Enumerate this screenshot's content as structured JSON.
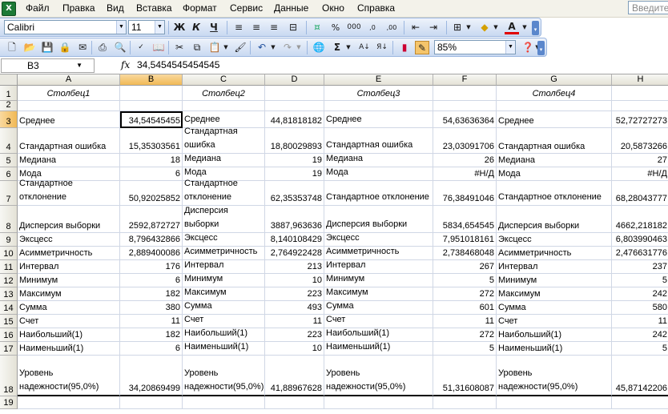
{
  "menu": {
    "items": [
      "Файл",
      "Правка",
      "Вид",
      "Вставка",
      "Формат",
      "Сервис",
      "Данные",
      "Окно",
      "Справка"
    ],
    "help_placeholder": "Введите"
  },
  "toolbar1": {
    "font_name": "Calibri",
    "font_size": "11"
  },
  "toolbar2": {
    "zoom": "85%"
  },
  "formula": {
    "cell_ref": "B3",
    "fx_label": "fx",
    "value": "34,5454545454545"
  },
  "columns": [
    "A",
    "B",
    "C",
    "D",
    "E",
    "F",
    "G",
    "H"
  ],
  "rows": {
    "r1": [
      "Столбец1",
      "",
      "Столбец2",
      "",
      "Столбец3",
      "",
      "Столбец4",
      ""
    ],
    "r2": [
      "",
      "",
      "",
      "",
      "",
      "",
      "",
      ""
    ],
    "r3": [
      "Среднее",
      "34,54545455",
      "Среднее",
      "44,81818182",
      "Среднее",
      "54,63636364",
      "Среднее",
      "52,72727273"
    ],
    "r4": [
      "Стандартная ошибка",
      "15,35303561",
      "Стандартная ошибка",
      "18,80029893",
      "Стандартная ошибка",
      "23,03091706",
      "Стандартная ошибка",
      "20,5873266"
    ],
    "r5": [
      "Медиана",
      "18",
      "Медиана",
      "19",
      "Медиана",
      "26",
      "Медиана",
      "27"
    ],
    "r6": [
      "Мода",
      "6",
      "Мода",
      "19",
      "Мода",
      "#Н/Д",
      "Мода",
      "#Н/Д"
    ],
    "r7": [
      "Стандартное отклонение",
      "50,92025852",
      "Стандартное отклонение",
      "62,35353748",
      "Стандартное отклонение",
      "76,38491046",
      "Стандартное отклонение",
      "68,28043777"
    ],
    "r8": [
      "Дисперсия выборки",
      "2592,872727",
      "Дисперсия выборки",
      "3887,963636",
      "Дисперсия выборки",
      "5834,654545",
      "Дисперсия выборки",
      "4662,218182"
    ],
    "r9": [
      "Эксцесс",
      "8,796432866",
      "Эксцесс",
      "8,140108429",
      "Эксцесс",
      "7,951018161",
      "Эксцесс",
      "6,803990463"
    ],
    "r10": [
      "Асимметричность",
      "2,889400086",
      "Асимметричность",
      "2,764922428",
      "Асимметричность",
      "2,738468048",
      "Асимметричность",
      "2,476631776"
    ],
    "r11": [
      "Интервал",
      "176",
      "Интервал",
      "213",
      "Интервал",
      "267",
      "Интервал",
      "237"
    ],
    "r12": [
      "Минимум",
      "6",
      "Минимум",
      "10",
      "Минимум",
      "5",
      "Минимум",
      "5"
    ],
    "r13": [
      "Максимум",
      "182",
      "Максимум",
      "223",
      "Максимум",
      "272",
      "Максимум",
      "242"
    ],
    "r14": [
      "Сумма",
      "380",
      "Сумма",
      "493",
      "Сумма",
      "601",
      "Сумма",
      "580"
    ],
    "r15": [
      "Счет",
      "11",
      "Счет",
      "11",
      "Счет",
      "11",
      "Счет",
      "11"
    ],
    "r16": [
      "Наибольший(1)",
      "182",
      "Наибольший(1)",
      "223",
      "Наибольший(1)",
      "272",
      "Наибольший(1)",
      "242"
    ],
    "r17": [
      "Наименьший(1)",
      "6",
      "Наименьший(1)",
      "10",
      "Наименьший(1)",
      "5",
      "Наименьший(1)",
      "5"
    ],
    "r18": [
      "Уровень надежности(95,0%)",
      "34,20869499",
      "Уровень надежности(95,0%)",
      "41,88967628",
      "Уровень надежности(95,0%)",
      "51,31608087",
      "Уровень надежности(95,0%)",
      "45,87142206"
    ],
    "r19": [
      "",
      "",
      "",
      "",
      "",
      "",
      "",
      ""
    ]
  },
  "row_numbers": [
    "1",
    "2",
    "3",
    "4",
    "5",
    "6",
    "7",
    "8",
    "9",
    "10",
    "11",
    "12",
    "13",
    "14",
    "15",
    "16",
    "17",
    "18",
    "19"
  ],
  "active_cell": "B3"
}
